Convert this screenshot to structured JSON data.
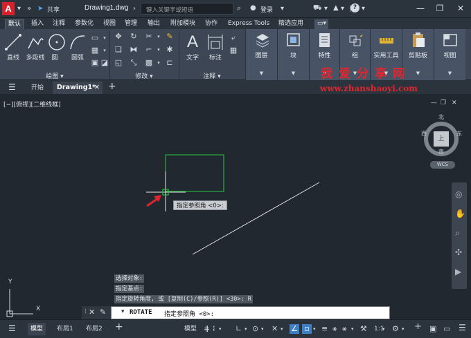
{
  "titlebar": {
    "logo_letter": "A",
    "share_label": "共享",
    "doc_title": "Drawing1.dwg",
    "search_placeholder": "键入关键字或短语",
    "login_label": "登录",
    "help_label": "?"
  },
  "ribbon_tabs": [
    "默认",
    "插入",
    "注释",
    "参数化",
    "视图",
    "管理",
    "输出",
    "附加模块",
    "协作",
    "Express Tools",
    "精选应用"
  ],
  "active_tab": "默认",
  "ribbon": {
    "draw_tools": [
      "直线",
      "多段线",
      "圆",
      "圆弧"
    ],
    "draw_panel_label": "绘图",
    "modify_panel_label": "修改",
    "annotation_tools": [
      "文字",
      "标注"
    ],
    "annotation_panel_label": "注释",
    "layers_label": "图层",
    "block_label": "块",
    "properties_label": "特性",
    "group_label": "组",
    "utilities_label": "实用工具",
    "clipboard_label": "剪贴板",
    "view_label": "视图"
  },
  "watermark": {
    "cn": "我爱分享网",
    "url": "www.zhanshaoyi.com"
  },
  "file_tabs": {
    "start": "开始",
    "drawing": "Drawing1*"
  },
  "canvas": {
    "view_label": "[−][俯视][二维线框]",
    "tooltip": "指定参照角 <0>:",
    "history": [
      "选择对象:",
      "指定基点:",
      "指定旋转角度, 或 [复制(C)/参照(R)] <30>:  R"
    ],
    "command_name": "ROTATE",
    "command_prompt": "指定参照角 <0>:",
    "ucs_x": "X",
    "ucs_y": "Y"
  },
  "navcube": {
    "north": "北",
    "south": "南",
    "east": "东",
    "west": "西",
    "top": "上",
    "wcs": "WCS"
  },
  "statusbar": {
    "tabs": [
      "模型",
      "布局1",
      "布局2"
    ],
    "model_label": "模型",
    "scale_label": "1:1"
  },
  "colors": {
    "accent_red": "#d7212b",
    "canvas_bg": "#212830",
    "ribbon_bg": "#3c4654",
    "selection_green": "#27c93f"
  }
}
